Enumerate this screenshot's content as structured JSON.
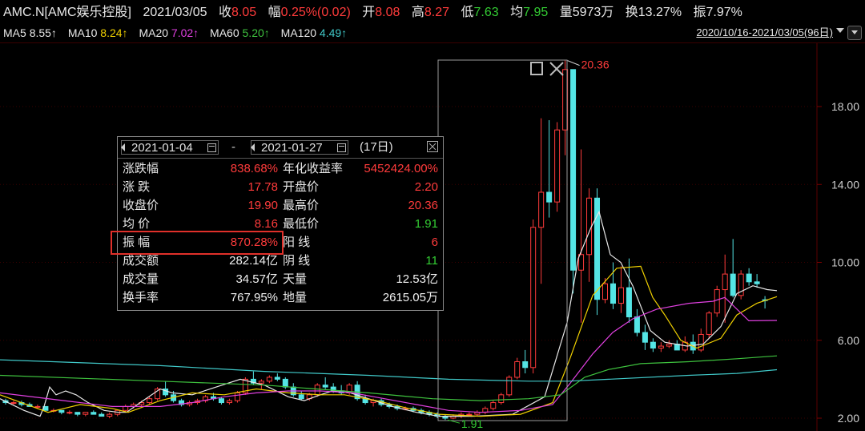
{
  "header": {
    "symbol": "AMC.N[AMC娱乐控股]",
    "date": "2021/03/05",
    "close_label": "收",
    "close": "8.05",
    "chg_label": "幅",
    "chg": "0.25%(0.02)",
    "open_label": "开",
    "open": "8.08",
    "high_label": "高",
    "high": "8.27",
    "low_label": "低",
    "low": "7.63",
    "avg_label": "均",
    "avg": "7.95",
    "vol_label": "量",
    "vol": "5973万",
    "turn_label": "换",
    "turn": "13.27%",
    "amp_label": "振",
    "amp": "7.97%"
  },
  "ma_bar": {
    "ma5_label": "MA5",
    "ma5": "8.55↑",
    "ma10_label": "MA10",
    "ma10": "8.24↑",
    "ma20_label": "MA20",
    "ma20": "7.02↑",
    "ma60_label": "MA60",
    "ma60": "5.20↑",
    "ma120_label": "MA120",
    "ma120": "4.49↑",
    "range": "2020/10/16-2021/03/05(96日)"
  },
  "colors": {
    "up": "#ff3b3b",
    "down": "#54e5e5",
    "ma5": "#e8e8e8",
    "ma10": "#f0d000",
    "ma20": "#e040e0",
    "ma60": "#3ec23e",
    "ma120": "#40c8c8",
    "bg": "#000000"
  },
  "stats_panel": {
    "start_date": "2021-01-04",
    "dash": "-",
    "end_date": "2021-01-27",
    "days": "(17日)",
    "rows": [
      {
        "l1": "涨跌幅",
        "v1": "838.68%",
        "l2": "年化收益率",
        "v2": "5452424.00%"
      },
      {
        "l1": "涨  跌",
        "v1": "17.78",
        "l2": "开盘价",
        "v2": "2.20"
      },
      {
        "l1": "收盘价",
        "v1": "19.90",
        "l2": "最高价",
        "v2": "20.36"
      },
      {
        "l1": "均  价",
        "v1": "8.16",
        "l2": "最低价",
        "v2": "1.91"
      },
      {
        "l1": "振  幅",
        "v1": "870.28%",
        "l2": "阳  线",
        "v2": "6"
      },
      {
        "l1": "成交额",
        "v1": "282.14亿",
        "l2": "阴  线",
        "v2": "11"
      },
      {
        "l1": "成交量",
        "v1": "34.57亿",
        "l2": "天量",
        "v2": "12.53亿"
      },
      {
        "l1": "换手率",
        "v1": "767.95%",
        "l2": "地量",
        "v2": "2615.05万"
      }
    ]
  },
  "chart_data": {
    "type": "candlestick",
    "y_ticks": [
      "18.00",
      "14.00",
      "10.00",
      "6.00",
      "2.00"
    ],
    "ylim": [
      1.5,
      20.7
    ],
    "max_label": "20.36",
    "min_label": "1.91",
    "candles": [
      [
        2.9,
        3.0,
        2.7,
        2.8
      ],
      [
        2.8,
        2.9,
        2.7,
        2.8
      ],
      [
        2.8,
        2.9,
        2.6,
        2.7
      ],
      [
        2.7,
        2.8,
        2.6,
        2.6
      ],
      [
        2.6,
        2.7,
        2.5,
        2.6
      ],
      [
        2.6,
        2.6,
        2.4,
        2.4
      ],
      [
        2.4,
        2.5,
        2.3,
        2.4
      ],
      [
        2.4,
        2.4,
        2.2,
        2.3
      ],
      [
        2.3,
        2.4,
        2.2,
        2.3
      ],
      [
        2.3,
        2.3,
        2.1,
        2.2
      ],
      [
        2.2,
        2.3,
        2.1,
        2.3
      ],
      [
        2.3,
        2.4,
        2.2,
        2.2
      ],
      [
        2.2,
        2.3,
        2.1,
        2.1
      ],
      [
        2.1,
        2.3,
        2.0,
        2.2
      ],
      [
        2.2,
        2.4,
        2.1,
        2.4
      ],
      [
        2.4,
        2.7,
        2.3,
        2.6
      ],
      [
        2.6,
        2.8,
        2.5,
        2.7
      ],
      [
        2.7,
        2.9,
        2.6,
        2.8
      ],
      [
        2.8,
        3.1,
        2.7,
        3.0
      ],
      [
        3.0,
        3.6,
        2.9,
        3.5
      ],
      [
        3.5,
        3.9,
        3.1,
        3.2
      ],
      [
        3.2,
        3.4,
        2.8,
        2.9
      ],
      [
        2.9,
        3.0,
        2.6,
        2.7
      ],
      [
        2.7,
        2.9,
        2.6,
        2.8
      ],
      [
        2.8,
        3.0,
        2.7,
        2.9
      ],
      [
        2.9,
        3.2,
        2.8,
        3.1
      ],
      [
        3.1,
        3.3,
        2.9,
        3.0
      ],
      [
        3.0,
        3.1,
        2.7,
        2.8
      ],
      [
        2.8,
        3.0,
        2.7,
        2.9
      ],
      [
        2.9,
        3.4,
        2.8,
        3.3
      ],
      [
        3.3,
        4.1,
        3.2,
        4.0
      ],
      [
        4.0,
        4.4,
        3.7,
        3.8
      ],
      [
        3.8,
        4.0,
        3.5,
        3.9
      ],
      [
        3.9,
        4.2,
        3.8,
        4.1
      ],
      [
        4.1,
        4.3,
        3.9,
        4.0
      ],
      [
        4.0,
        4.1,
        3.5,
        3.6
      ],
      [
        3.6,
        3.8,
        3.1,
        3.2
      ],
      [
        3.2,
        3.4,
        2.9,
        3.0
      ],
      [
        3.0,
        3.3,
        2.9,
        3.2
      ],
      [
        3.2,
        3.8,
        3.1,
        3.7
      ],
      [
        3.7,
        4.1,
        3.5,
        3.6
      ],
      [
        3.6,
        3.8,
        3.3,
        3.4
      ],
      [
        3.4,
        3.7,
        3.2,
        3.3
      ],
      [
        3.3,
        3.8,
        3.2,
        3.7
      ],
      [
        3.7,
        3.9,
        2.9,
        3.0
      ],
      [
        3.0,
        3.2,
        2.7,
        2.8
      ],
      [
        2.8,
        3.0,
        2.6,
        2.9
      ],
      [
        2.9,
        3.0,
        2.6,
        2.7
      ],
      [
        2.7,
        2.8,
        2.5,
        2.6
      ],
      [
        2.6,
        2.7,
        2.4,
        2.5
      ],
      [
        2.5,
        2.6,
        2.4,
        2.5
      ],
      [
        2.5,
        2.6,
        2.3,
        2.4
      ],
      [
        2.4,
        2.5,
        2.2,
        2.3
      ],
      [
        2.3,
        2.4,
        2.1,
        2.2
      ],
      [
        2.2,
        2.3,
        2.0,
        2.1
      ],
      [
        2.1,
        2.2,
        1.91,
        2.0
      ],
      [
        2.0,
        2.2,
        1.95,
        2.1
      ],
      [
        2.1,
        2.3,
        2.0,
        2.2
      ],
      [
        2.2,
        2.3,
        2.1,
        2.2
      ],
      [
        2.2,
        2.4,
        2.1,
        2.3
      ],
      [
        2.3,
        2.6,
        2.2,
        2.5
      ],
      [
        2.5,
        2.9,
        2.4,
        2.8
      ],
      [
        2.8,
        3.3,
        2.7,
        3.2
      ],
      [
        3.2,
        4.2,
        3.1,
        4.1
      ],
      [
        4.1,
        5.1,
        4.0,
        4.9
      ],
      [
        4.9,
        5.5,
        4.3,
        4.6
      ],
      [
        4.6,
        12.2,
        4.3,
        11.8
      ],
      [
        11.8,
        17.4,
        8.9,
        13.6
      ],
      [
        13.6,
        17.3,
        12.3,
        13.1
      ],
      [
        13.1,
        17.2,
        12.6,
        16.8
      ],
      [
        16.8,
        20.36,
        15.5,
        19.9
      ],
      [
        19.9,
        19.9,
        8.4,
        9.6
      ],
      [
        9.6,
        15.8,
        6.9,
        10.4
      ],
      [
        10.4,
        13.8,
        9.0,
        13.3
      ],
      [
        13.3,
        13.8,
        7.3,
        8.1
      ],
      [
        8.1,
        9.2,
        7.9,
        8.9
      ],
      [
        8.9,
        10.0,
        7.6,
        7.9
      ],
      [
        7.9,
        9.8,
        7.4,
        8.7
      ],
      [
        8.7,
        10.2,
        6.9,
        7.2
      ],
      [
        7.2,
        7.6,
        6.2,
        6.4
      ],
      [
        6.4,
        6.8,
        5.5,
        5.9
      ],
      [
        5.9,
        6.1,
        5.4,
        5.6
      ],
      [
        5.6,
        5.9,
        5.4,
        5.7
      ],
      [
        5.7,
        6.0,
        5.6,
        5.8
      ],
      [
        5.8,
        6.0,
        5.5,
        5.5
      ],
      [
        5.5,
        6.2,
        5.4,
        5.9
      ],
      [
        5.9,
        6.3,
        5.3,
        5.5
      ],
      [
        5.5,
        6.6,
        5.4,
        6.3
      ],
      [
        6.3,
        7.5,
        6.1,
        7.4
      ],
      [
        7.4,
        8.8,
        7.2,
        8.6
      ],
      [
        8.6,
        10.4,
        6.9,
        9.4
      ],
      [
        9.4,
        11.2,
        8.2,
        8.3
      ],
      [
        8.3,
        9.6,
        8.1,
        9.4
      ],
      [
        9.4,
        9.7,
        8.8,
        9.0
      ],
      [
        9.0,
        9.4,
        8.7,
        8.9
      ],
      [
        8.08,
        8.27,
        7.63,
        8.05
      ]
    ],
    "ma5": [
      [
        0,
        3.0
      ],
      [
        30,
        2.4
      ],
      [
        50,
        2.1
      ],
      [
        55,
        2.6
      ],
      [
        62,
        3.6
      ],
      [
        70,
        3.2
      ],
      [
        82,
        3.4
      ],
      [
        95,
        3.2
      ],
      [
        110,
        2.8
      ],
      [
        120,
        2.6
      ],
      [
        130,
        2.4
      ],
      [
        148,
        2.3
      ],
      [
        158,
        2.3
      ],
      [
        175,
        2.8
      ],
      [
        200,
        3.5
      ],
      [
        215,
        3.3
      ],
      [
        240,
        3.2
      ],
      [
        270,
        3.6
      ],
      [
        300,
        4.0
      ],
      [
        330,
        3.7
      ],
      [
        360,
        3.1
      ],
      [
        380,
        2.9
      ],
      [
        400,
        3.2
      ],
      [
        415,
        3.4
      ],
      [
        430,
        3.4
      ],
      [
        460,
        3.0
      ],
      [
        490,
        2.6
      ],
      [
        520,
        2.3
      ],
      [
        548,
        2.1
      ],
      [
        590,
        2.1
      ],
      [
        640,
        2.2
      ],
      [
        680,
        3.1
      ],
      [
        708,
        6.9
      ],
      [
        722,
        10.2
      ],
      [
        738,
        11.8
      ],
      [
        748,
        12.6
      ],
      [
        762,
        10.4
      ],
      [
        775,
        10.0
      ],
      [
        790,
        8.8
      ],
      [
        812,
        6.5
      ],
      [
        830,
        5.9
      ],
      [
        858,
        5.7
      ],
      [
        878,
        5.8
      ],
      [
        900,
        6.7
      ],
      [
        920,
        8.4
      ],
      [
        940,
        8.8
      ],
      [
        958,
        8.6
      ],
      [
        970,
        8.55
      ]
    ],
    "ma10": [
      [
        0,
        3.2
      ],
      [
        40,
        2.6
      ],
      [
        60,
        2.3
      ],
      [
        100,
        2.7
      ],
      [
        140,
        2.5
      ],
      [
        160,
        2.3
      ],
      [
        200,
        2.9
      ],
      [
        240,
        3.3
      ],
      [
        280,
        3.2
      ],
      [
        320,
        3.5
      ],
      [
        360,
        3.3
      ],
      [
        400,
        3.2
      ],
      [
        430,
        3.2
      ],
      [
        470,
        2.9
      ],
      [
        510,
        2.5
      ],
      [
        548,
        2.2
      ],
      [
        600,
        2.1
      ],
      [
        650,
        2.2
      ],
      [
        690,
        2.8
      ],
      [
        712,
        5.1
      ],
      [
        740,
        8.3
      ],
      [
        770,
        9.7
      ],
      [
        800,
        9.8
      ],
      [
        815,
        8.2
      ],
      [
        830,
        7.3
      ],
      [
        850,
        6.0
      ],
      [
        870,
        5.6
      ],
      [
        900,
        6.1
      ],
      [
        920,
        7.3
      ],
      [
        945,
        7.9
      ],
      [
        970,
        8.24
      ]
    ],
    "ma20": [
      [
        0,
        3.3
      ],
      [
        80,
        2.9
      ],
      [
        140,
        2.6
      ],
      [
        200,
        2.6
      ],
      [
        240,
        2.8
      ],
      [
        280,
        3.1
      ],
      [
        320,
        3.3
      ],
      [
        360,
        3.4
      ],
      [
        400,
        3.4
      ],
      [
        440,
        3.3
      ],
      [
        480,
        3.0
      ],
      [
        520,
        2.7
      ],
      [
        560,
        2.4
      ],
      [
        600,
        2.3
      ],
      [
        650,
        2.4
      ],
      [
        690,
        2.7
      ],
      [
        712,
        3.8
      ],
      [
        740,
        5.3
      ],
      [
        765,
        6.4
      ],
      [
        790,
        7.1
      ],
      [
        820,
        7.6
      ],
      [
        860,
        7.9
      ],
      [
        890,
        8.0
      ],
      [
        905,
        8.2
      ],
      [
        935,
        7.0
      ],
      [
        970,
        7.02
      ]
    ],
    "ma60": [
      [
        0,
        4.2
      ],
      [
        200,
        3.9
      ],
      [
        330,
        3.7
      ],
      [
        460,
        3.3
      ],
      [
        540,
        3.0
      ],
      [
        600,
        2.9
      ],
      [
        660,
        3.0
      ],
      [
        700,
        3.2
      ],
      [
        730,
        4.1
      ],
      [
        760,
        4.5
      ],
      [
        800,
        4.8
      ],
      [
        860,
        4.9
      ],
      [
        920,
        5.05
      ],
      [
        970,
        5.2
      ]
    ],
    "ma120": [
      [
        0,
        5.0
      ],
      [
        200,
        4.7
      ],
      [
        330,
        4.4
      ],
      [
        460,
        4.2
      ],
      [
        560,
        4.0
      ],
      [
        660,
        3.9
      ],
      [
        710,
        3.9
      ],
      [
        760,
        4.0
      ],
      [
        860,
        4.2
      ],
      [
        920,
        4.3
      ],
      [
        970,
        4.49
      ]
    ]
  }
}
